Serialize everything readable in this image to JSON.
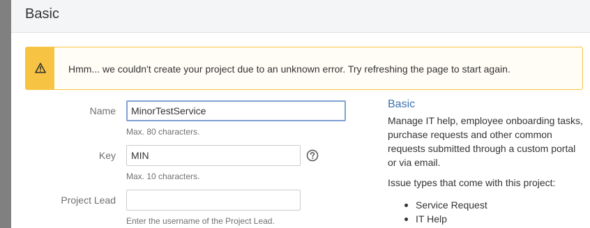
{
  "dialog": {
    "title": "Basic"
  },
  "warning": {
    "icon": "warning-triangle-icon",
    "message": "Hmm... we couldn't create your project due to an unknown error. Try refreshing the page to start again."
  },
  "form": {
    "name": {
      "label": "Name",
      "value": "MinorTestService",
      "help": "Max. 80 characters."
    },
    "key": {
      "label": "Key",
      "value": "MIN",
      "help": "Max. 10 characters.",
      "help_icon": "question-circle-icon"
    },
    "project_lead": {
      "label": "Project Lead",
      "value": "",
      "help": "Enter the username of the Project Lead."
    }
  },
  "template_info": {
    "title": "Basic",
    "description": "Manage IT help, employee onboarding tasks, purchase requests and other common requests submitted through a custom portal or via email.",
    "issue_types_heading": "Issue types that come with this project:",
    "issue_types": [
      "Service Request",
      "IT Help"
    ]
  },
  "colors": {
    "warning_accent": "#f6c342",
    "link_blue": "#3b73af",
    "focus_border": "#7ea1d3"
  }
}
